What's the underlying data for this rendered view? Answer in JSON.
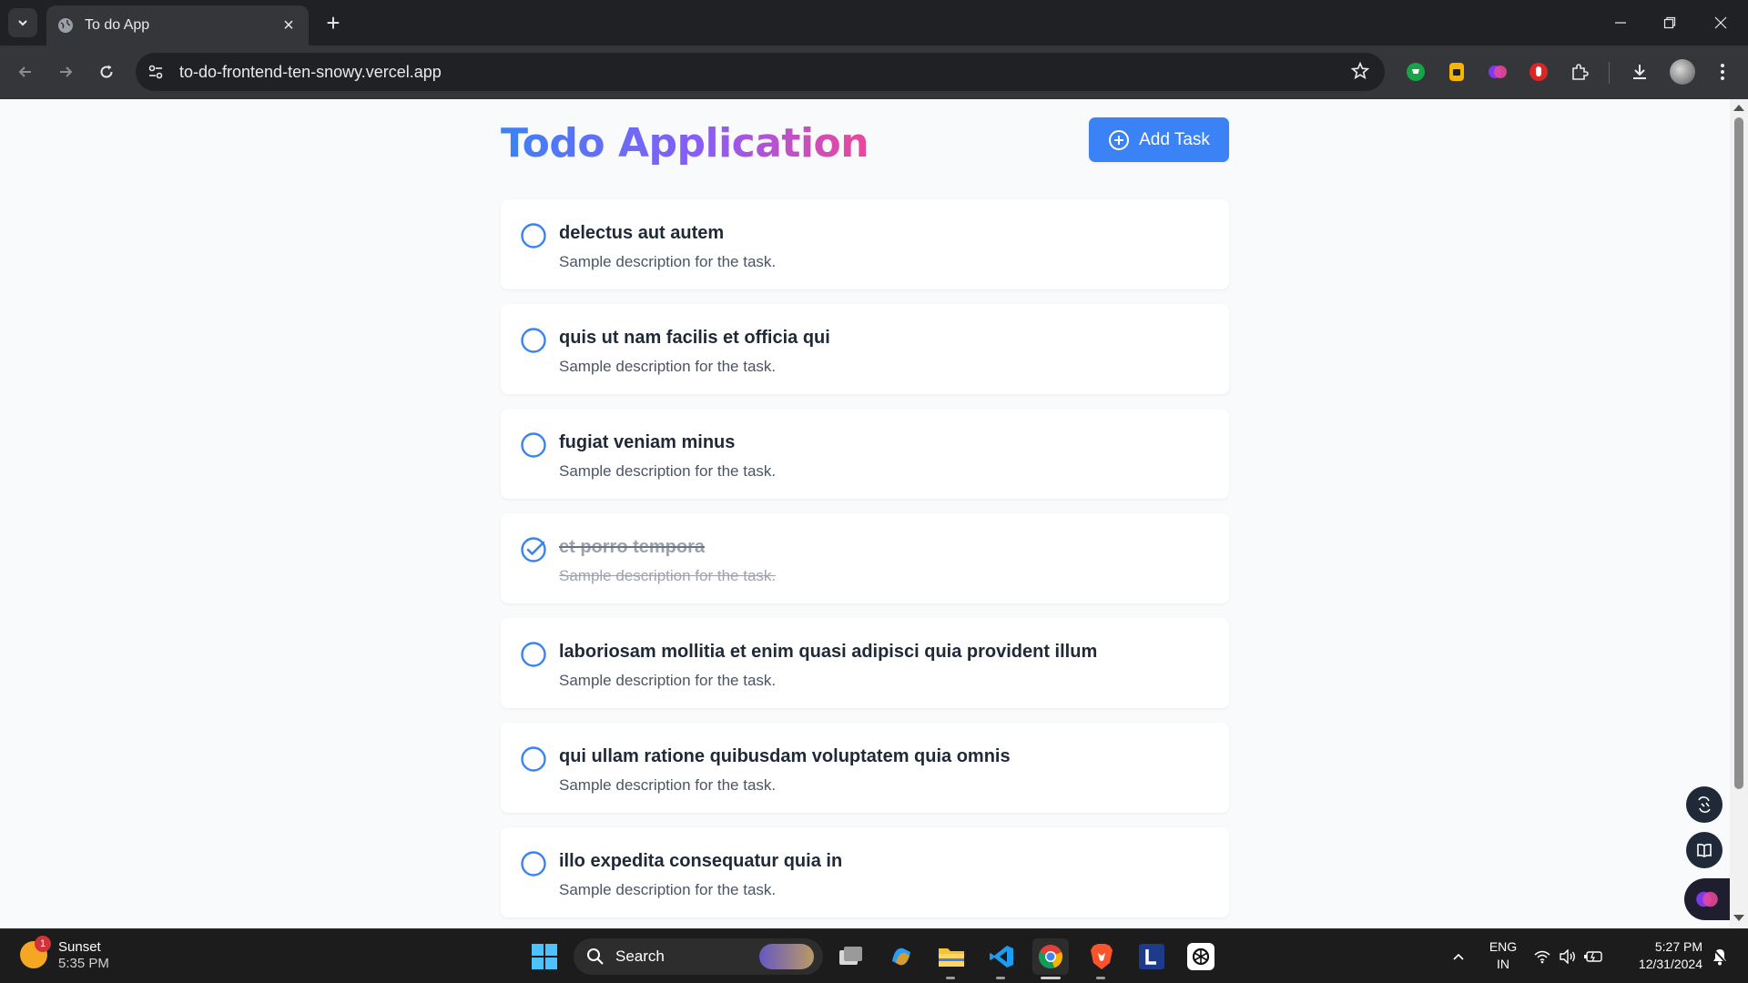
{
  "browser": {
    "tab_title": "To do App",
    "url": "to-do-frontend-ten-snowy.vercel.app"
  },
  "app": {
    "title": "Todo Application",
    "add_button_label": "Add Task",
    "colors": {
      "primary": "#3b82f6",
      "gradient_mid": "#8b5cf6",
      "gradient_end": "#ec4899"
    }
  },
  "tasks": [
    {
      "title": "delectus aut autem",
      "description": "Sample description for the task.",
      "completed": false
    },
    {
      "title": "quis ut nam facilis et officia qui",
      "description": "Sample description for the task.",
      "completed": false
    },
    {
      "title": "fugiat veniam minus",
      "description": "Sample description for the task.",
      "completed": false
    },
    {
      "title": "et porro tempora",
      "description": "Sample description for the task.",
      "completed": true
    },
    {
      "title": "laboriosam mollitia et enim quasi adipisci quia provident illum",
      "description": "Sample description for the task.",
      "completed": false
    },
    {
      "title": "qui ullam ratione quibusdam voluptatem quia omnis",
      "description": "Sample description for the task.",
      "completed": false
    },
    {
      "title": "illo expedita consequatur quia in",
      "description": "Sample description for the task.",
      "completed": false
    }
  ],
  "taskbar": {
    "weather_label": "Sunset",
    "weather_time": "5:35 PM",
    "weather_badge": "1",
    "search_label": "Search",
    "lang_top": "ENG",
    "lang_bottom": "IN",
    "clock_time": "5:27 PM",
    "clock_date": "12/31/2024"
  }
}
